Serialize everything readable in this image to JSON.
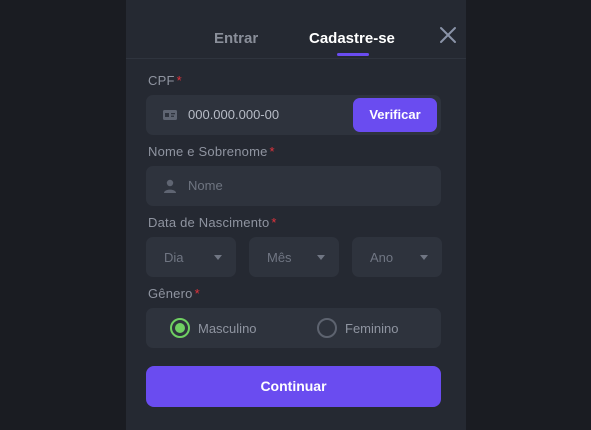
{
  "tabs": {
    "login": "Entrar",
    "signup": "Cadastre-se"
  },
  "cpf": {
    "label": "CPF",
    "required_mark": "*",
    "value": "000.000.000-00",
    "verify_button": "Verificar"
  },
  "name": {
    "label": "Nome e Sobrenome",
    "required_mark": "*",
    "placeholder": "Nome"
  },
  "birthdate": {
    "label": "Data de Nascimento",
    "required_mark": "*",
    "day": "Dia",
    "month": "Mês",
    "year": "Ano"
  },
  "gender": {
    "label": "Gênero",
    "required_mark": "*",
    "options": [
      "Masculino",
      "Feminino"
    ],
    "selected": "Masculino"
  },
  "continue_button": "Continuar",
  "colors": {
    "accent": "#6a4cf0",
    "selected_radio": "#6fcf62",
    "required": "#e2333c"
  }
}
